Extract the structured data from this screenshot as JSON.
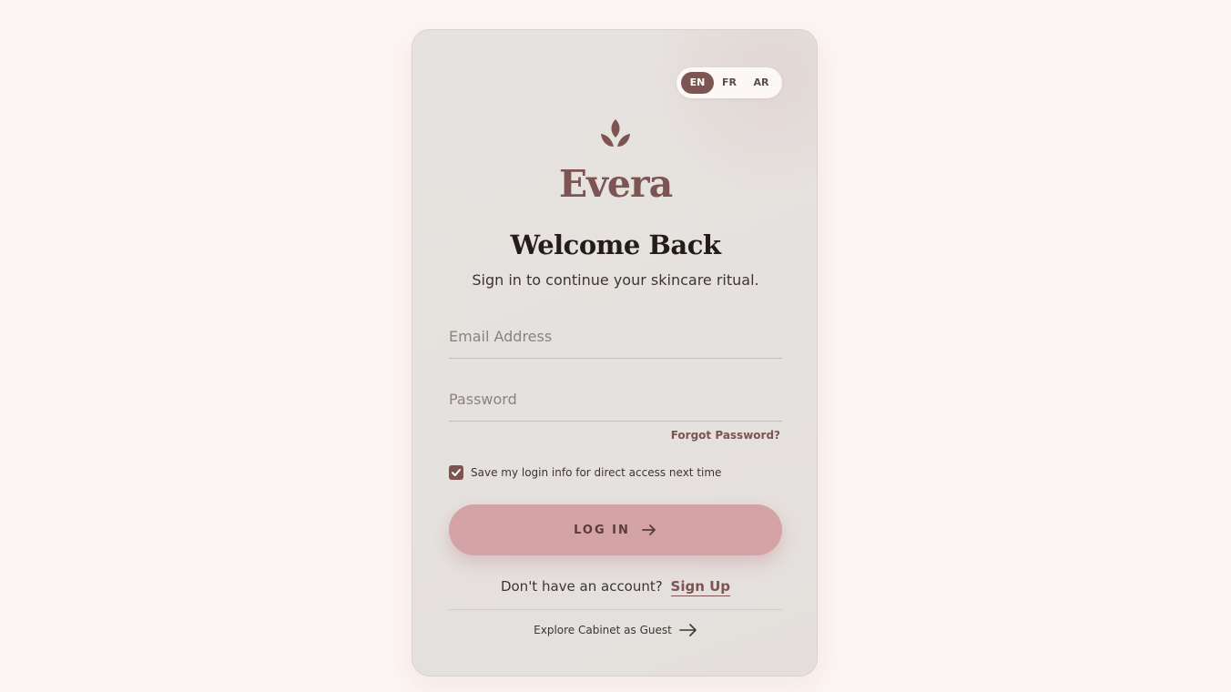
{
  "brand": {
    "name": "Evera",
    "logo_icon": "leaf-lotus-icon",
    "accent_color": "#7c5452",
    "button_color": "#d4a3a5"
  },
  "language": {
    "options": [
      "EN",
      "FR",
      "AR"
    ],
    "selected": "EN"
  },
  "header": {
    "title": "Welcome Back",
    "subtitle": "Sign in to continue your skincare ritual."
  },
  "form": {
    "email_placeholder": "Email Address",
    "email_value": "",
    "password_placeholder": "Password",
    "password_value": "",
    "forgot_label": "Forgot Password?",
    "remember_label": "Save my login info for direct access next time",
    "remember_checked": true,
    "login_label": "LOG IN"
  },
  "footer": {
    "signup_prompt": "Don't have an account?",
    "signup_label": "Sign Up",
    "guest_label": "Explore Cabinet as Guest"
  }
}
